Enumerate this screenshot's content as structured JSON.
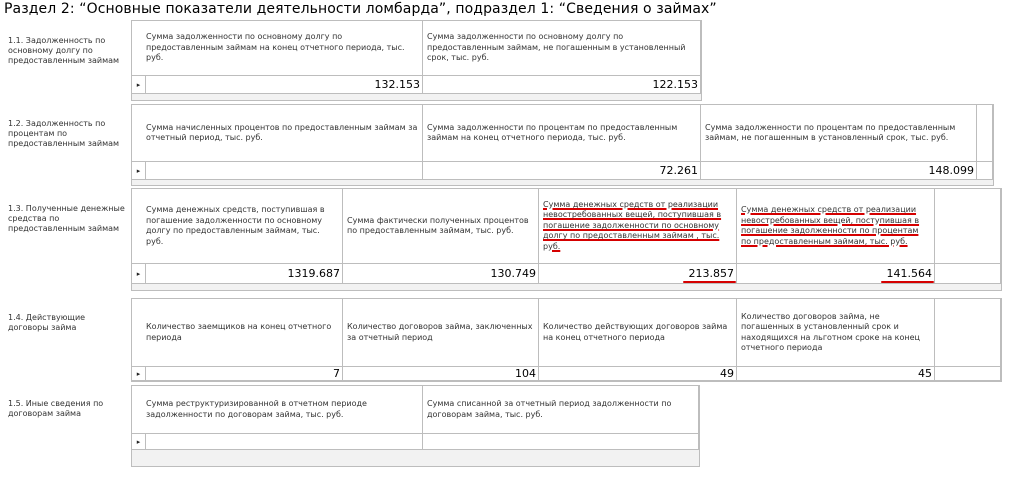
{
  "page": {
    "title": "Раздел 2: “Основные показатели деятельности ломбарда”, подраздел 1: “Сведения о займах”"
  },
  "sections": [
    {
      "label": "1.1. Задолженность по основному долгу по предоставленным займам",
      "headers": [
        "Сумма задолженности по основному долгу по предоставленным займам на конец отчетного периода, тыс. руб.",
        "Сумма задолженности по основному долгу по предоставленным займам, не погашенным в установленный срок, тыс. руб."
      ],
      "values": [
        "132.153",
        "122.153"
      ]
    },
    {
      "label": "1.2. Задолженность по процентам по предоставленным займам",
      "headers": [
        "Сумма начисленных процентов по предоставленным займам за отчетный период, тыс. руб.",
        "Сумма задолженности по процентам по предоставленным займам на конец отчетного периода, тыс. руб.",
        "Сумма задолженности по процентам по предоставленным займам, не погашенным в установленный срок, тыс. руб."
      ],
      "values": [
        "",
        "72.261",
        "148.099"
      ]
    },
    {
      "label": "1.3. Полученные денежные средства по предоставленным займам",
      "headers": [
        "Сумма денежных средств, поступившая в погашение задолженности по основному долгу по предоставленным займам, тыс. руб.",
        "Сумма фактически полученных процентов по предоставленным займам, тыс. руб.",
        "Сумма денежных средств от реализации невостребованных вещей, поступившая в погашение задолженности по основному долгу по предоставленным займам , тыс. руб.",
        "Сумма денежных средств от реализации невостребованных вещей, поступившая в погашение задолженности по процентам по предоставленным займам, тыс. руб."
      ],
      "values": [
        "1319.687",
        "130.749",
        "213.857",
        "141.564"
      ]
    },
    {
      "label": "1.4. Действующие договоры займа",
      "headers": [
        "Количество заемщиков на конец отчетного периода",
        "Количество договоров займа, заключенных за отчетный период",
        "Количество действующих договоров займа на конец отчетного периода",
        "Количество договоров займа, не погашенных в установленный срок и находящихся на льготном сроке на конец отчетного периода"
      ],
      "values": [
        "7",
        "104",
        "49",
        "45"
      ]
    },
    {
      "label": "1.5. Иные сведения по договорам займа",
      "headers": [
        "Сумма реструктуризированной в отчетном периоде задолженности по договорам займа, тыс. руб.",
        "Сумма списанной за отчетный период задолженности по договорам займа, тыс. руб."
      ],
      "values": [
        "",
        ""
      ]
    }
  ],
  "row_selector_glyph": "▸",
  "colors": {
    "highlight": "#d50000",
    "border": "#bdbdbd",
    "empty_area": "#f2f2f2"
  }
}
